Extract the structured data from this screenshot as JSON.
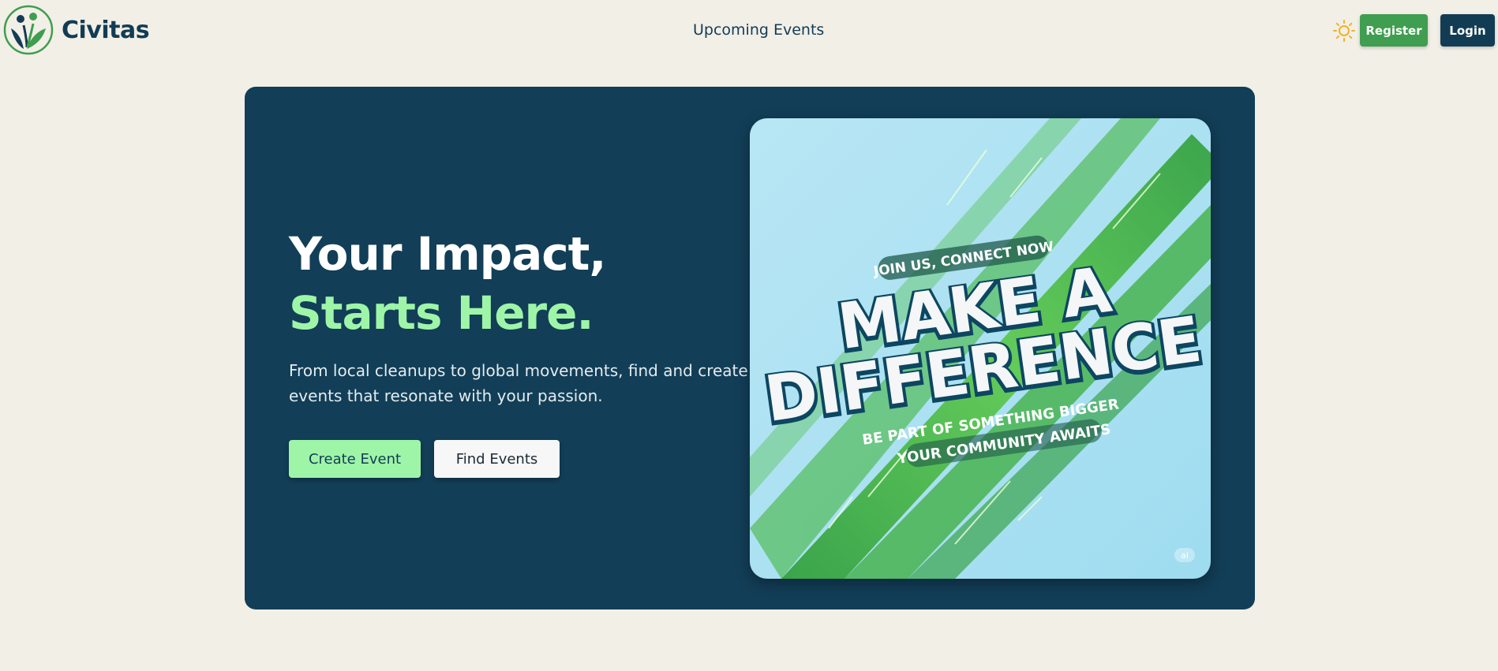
{
  "brand": {
    "name": "Civitas",
    "logo_icon": "civitas-leaf-people-logo"
  },
  "nav": {
    "upcoming_events": "Upcoming Events"
  },
  "header_actions": {
    "theme_icon": "sun-icon",
    "register_label": "Register",
    "login_label": "Login"
  },
  "hero": {
    "title_part1": "Your Impact, ",
    "title_accent": "Starts Here.",
    "subtitle": "From local cleanups to global movements, find and create events that resonate with your passion.",
    "create_event_label": "Create Event",
    "find_events_label": "Find Events",
    "image": {
      "tagline_top": "JOIN US, CONNECT NOW",
      "headline_line1": "MAKE A",
      "headline_line2": "DIFFERENCE",
      "tagline_bottom1": "BE PART OF SOMETHING BIGGER",
      "tagline_bottom2": "YOUR COMMUNITY AWAITS",
      "watermark": "ai"
    }
  },
  "colors": {
    "page_bg": "#f2efe7",
    "navy": "#123e57",
    "accent_green": "#9ef5a8",
    "register_green": "#3f9e4f"
  }
}
